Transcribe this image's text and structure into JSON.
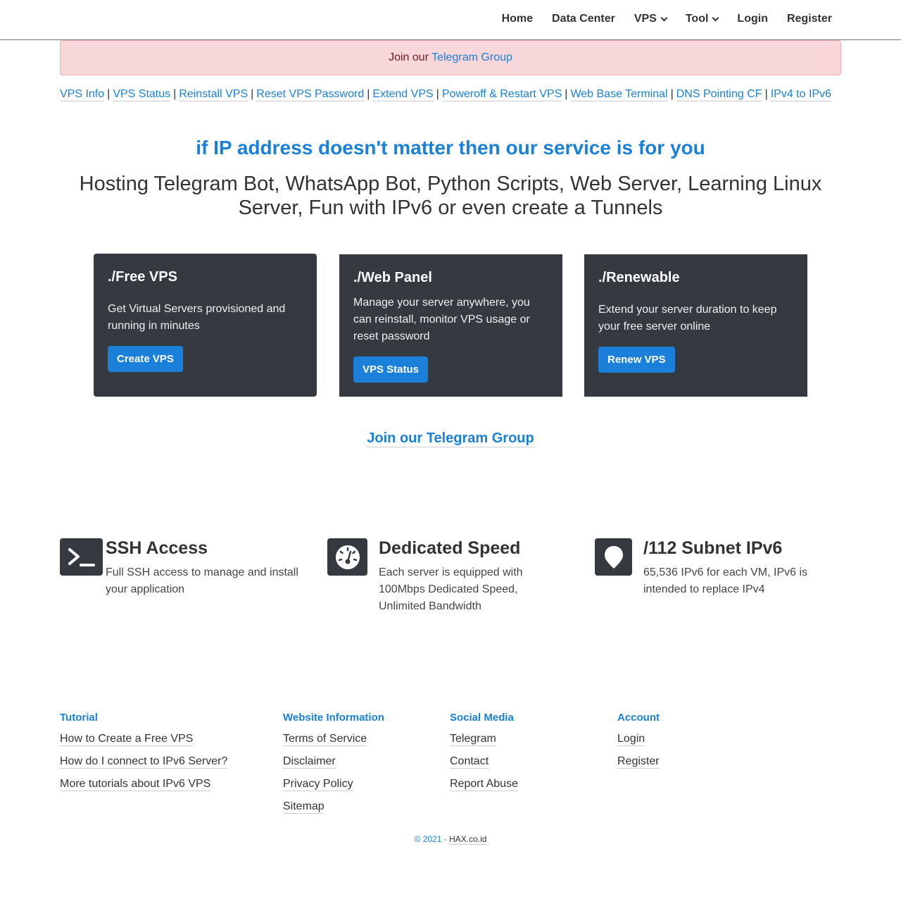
{
  "nav": {
    "home": "Home",
    "data_center": "Data Center",
    "vps": "VPS",
    "tool": "Tool",
    "login": "Login",
    "register": "Register"
  },
  "alert": {
    "prefix": "Join our",
    "link": "Telegram Group"
  },
  "quick_links": [
    "VPS Info",
    "VPS Status",
    "Reinstall VPS",
    "Reset VPS Password",
    "Extend VPS",
    "Poweroff & Restart VPS",
    "Web Base Terminal",
    "DNS Pointing CF",
    "IPv4 to IPv6"
  ],
  "hero": {
    "tagline": "if IP address doesn't matter then our service is for you",
    "subtitle": "Hosting Telegram Bot, WhatsApp Bot, Python Scripts, Web Server, Learning Linux Server, Fun with IPv6 or even create a Tunnels"
  },
  "cards": [
    {
      "title": "./Free VPS",
      "text": "Get Virtual Servers provisioned and running in minutes",
      "button": "Create VPS"
    },
    {
      "title": "./Web Panel",
      "text": "Manage your server anywhere, you can reinstall, monitor VPS usage or reset password",
      "button": "VPS Status"
    },
    {
      "title": "./Renewable",
      "text": "Extend your server duration to keep your free server online",
      "button": "Renew VPS"
    }
  ],
  "telegram_cta": "Join our Telegram Group",
  "features": [
    {
      "icon": "terminal-icon",
      "title": "SSH Access",
      "text": "Full SSH access to manage and install your application"
    },
    {
      "icon": "speedometer-icon",
      "title": "Dedicated Speed",
      "text": "Each server is equipped with 100Mbps Dedicated Speed, Unlimited Bandwidth"
    },
    {
      "icon": "location-pin-icon",
      "title": "/112 Subnet IPv6",
      "text": "65,536 IPv6 for each VM, IPv6 is intended to replace IPv4"
    }
  ],
  "footer": {
    "tutorial": {
      "heading": "Tutorial",
      "links": [
        "How to Create a Free VPS",
        "How do I connect to IPv6 Server?",
        "More tutorials about IPv6 VPS"
      ]
    },
    "website_info": {
      "heading": "Website Information",
      "links": [
        "Terms of Service",
        "Disclaimer",
        "Privacy Policy",
        "Sitemap"
      ]
    },
    "social": {
      "heading": "Social Media",
      "links": [
        "Telegram",
        "Contact",
        "Report Abuse"
      ]
    },
    "account": {
      "heading": "Account",
      "links": [
        "Login",
        "Register"
      ]
    },
    "copyright_prefix": "© 2021 -",
    "copyright_site": "HAX.co.id"
  },
  "colors": {
    "accent": "#1a80d9",
    "card_bg": "#343a40",
    "alert_bg": "#f8d7da"
  }
}
